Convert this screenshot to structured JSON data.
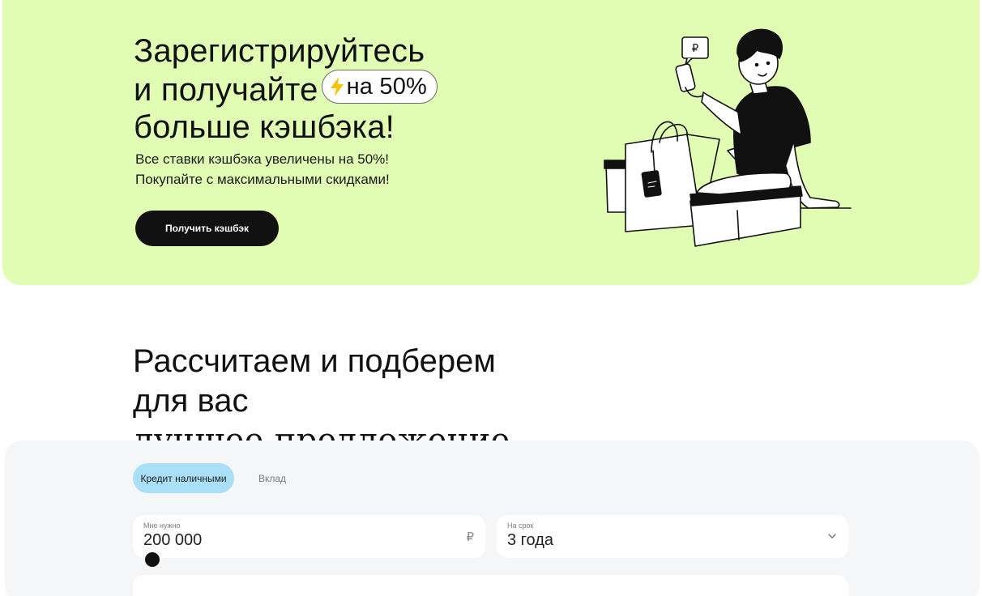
{
  "hero": {
    "title_line1": "Зарегистрируйтесь",
    "title_line2": "и получайте",
    "badge": "на 50%",
    "title_line3": "больше кэшбэка!",
    "subtitle_line1": "Все ставки кэшбэка увеличены на 50%!",
    "subtitle_line2": "Покупайте с максимальными скидками!",
    "button_label": "Получить кэшбэк",
    "bubble_symbol": "₽",
    "colors": {
      "background": "#e1fdb3",
      "button": "#111111",
      "bolt": "#f5c400"
    },
    "icons": [
      "lightning-icon",
      "shopper-illustration"
    ]
  },
  "calculator": {
    "title_line1": "Рассчитаем и подберем",
    "title_line2_a": "для вас ",
    "title_line2_b": "лучшее предложение",
    "tabs": [
      {
        "label": "Кредит наличными",
        "active": true
      },
      {
        "label": "Вклад",
        "active": false
      }
    ],
    "amount": {
      "label": "Мне нужно",
      "value": "200 000",
      "currency": "₽"
    },
    "term": {
      "label": "На срок",
      "value": "3 года"
    },
    "colors": {
      "panel": "#f4f6f7",
      "active_tab": "#a9dff7"
    }
  }
}
